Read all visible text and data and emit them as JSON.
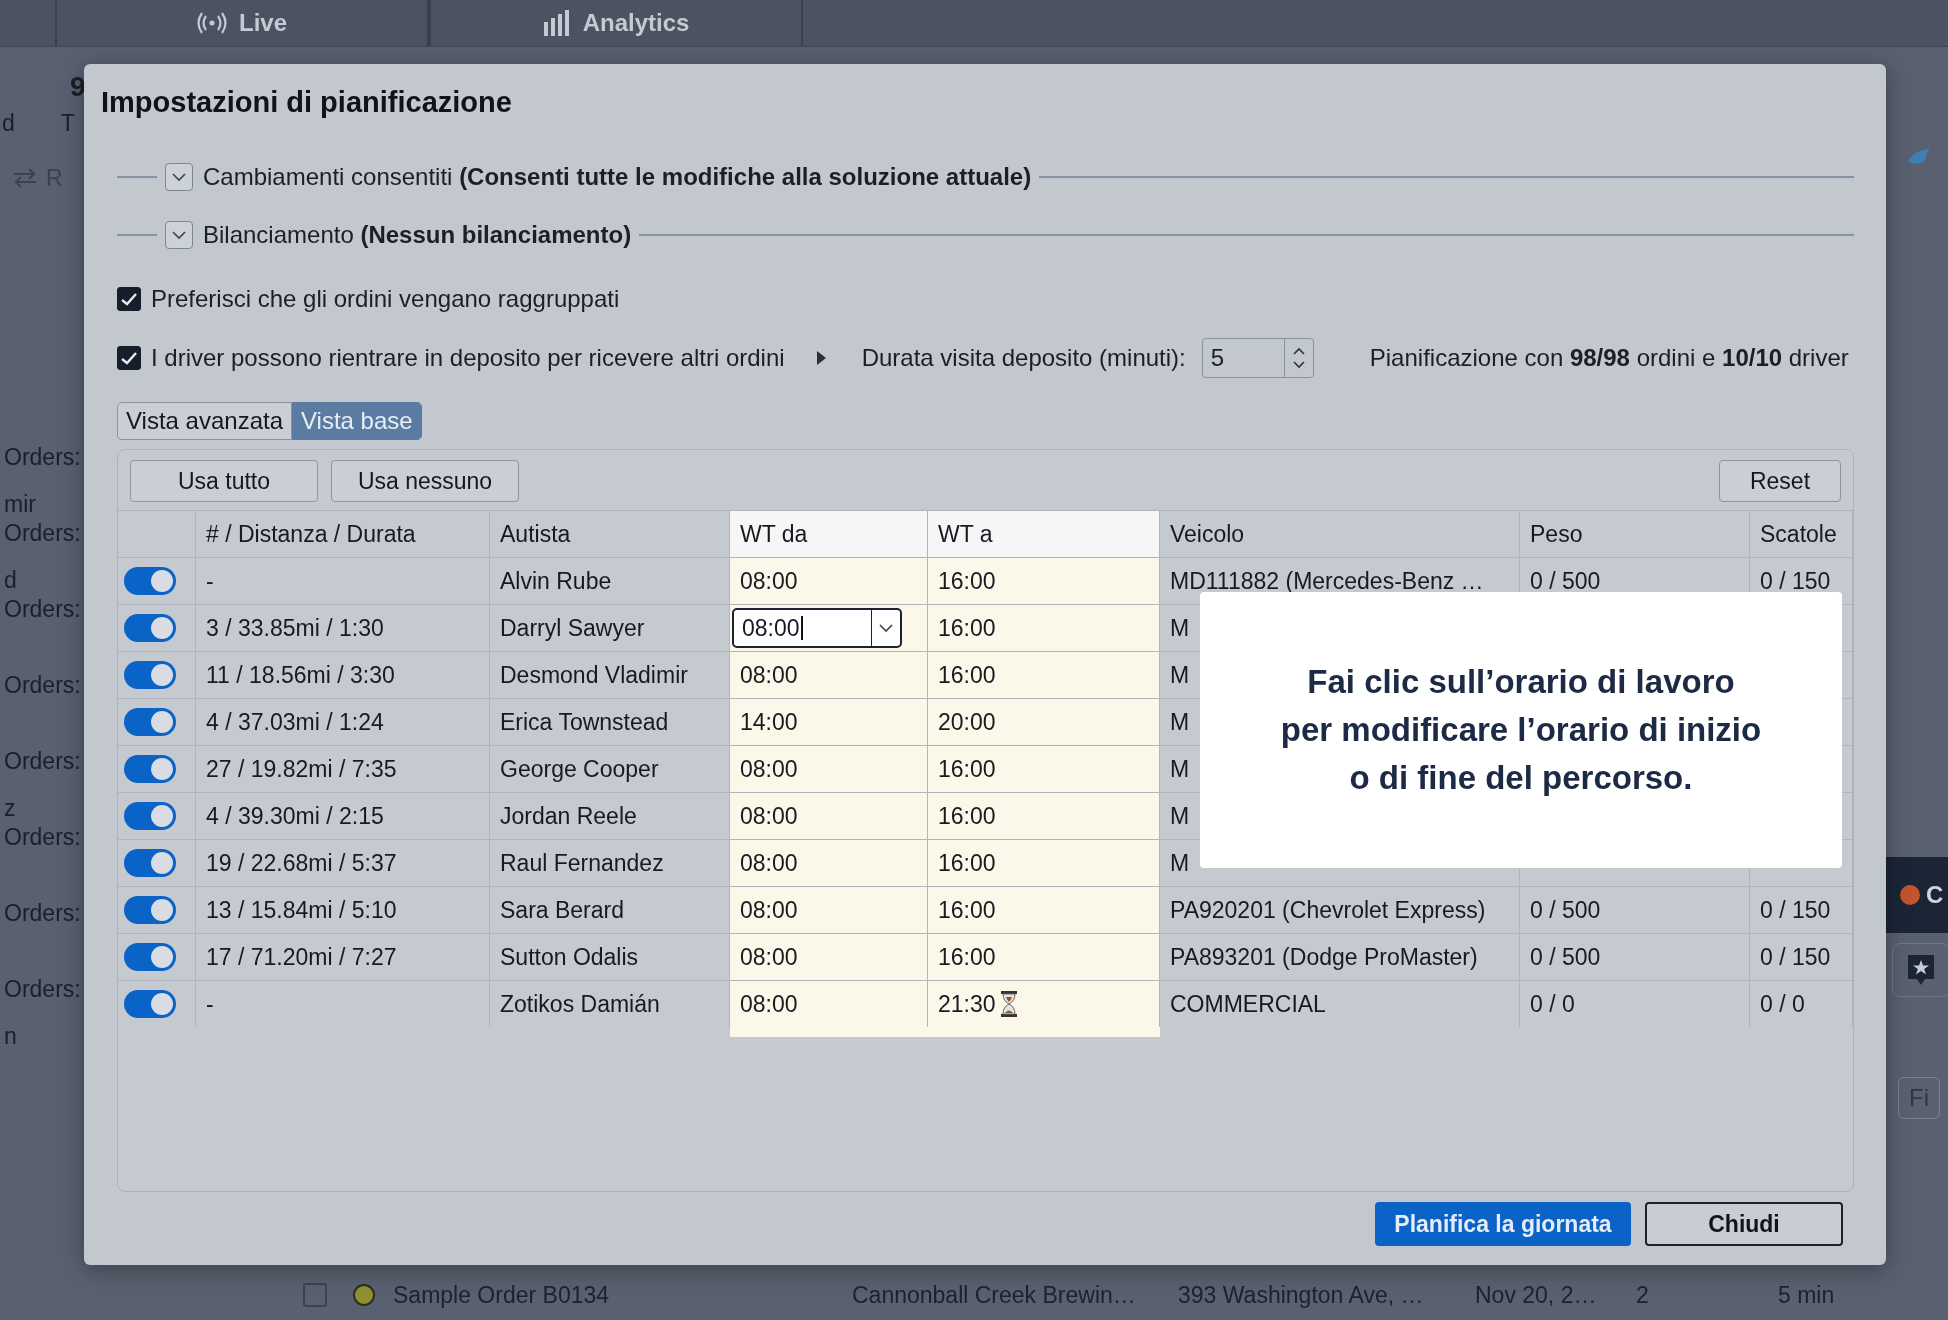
{
  "app_tabs": [
    "Live",
    "Analytics"
  ],
  "sidebar": {
    "heading": "9",
    "line": [
      "d",
      "T"
    ],
    "action": "R",
    "entries": [
      {
        "label": "Orders:"
      },
      {
        "name": "mir",
        "label": "Orders:"
      },
      {
        "name": "d",
        "label": "Orders:"
      },
      {
        "label": "Orders:"
      },
      {
        "label": "Orders:"
      },
      {
        "name": "z",
        "label": "Orders:"
      },
      {
        "label": "Orders:"
      },
      {
        "label": "Orders:"
      },
      {
        "name": "n"
      }
    ]
  },
  "right_panel": {
    "status": {
      "label": "C",
      "color": "#c4532f"
    },
    "filter": "Fi"
  },
  "order_row": {
    "checked": false,
    "color": "#8e9031",
    "cells": [
      "Sample Order B0134",
      "Cannonball Creek Brewin…",
      "393 Washington Ave, …",
      "Nov 20, 2…",
      "2",
      "5 min"
    ]
  },
  "dialog": {
    "title": "Impostazioni di pianificazione",
    "sections": [
      {
        "label": "Cambiamenti consentiti **(Consenti tutte le modifiche alla soluzione attuale)**",
        "expanded": false
      },
      {
        "label": "Bilanciamento **(Nessun bilanciamento)**",
        "expanded": false
      }
    ],
    "options": [
      {
        "label": "Preferisci che gli ordini vengano raggruppati",
        "checked": true
      },
      {
        "label": "I driver possono rientrare in deposito per ricevere altri ordini",
        "checked": true
      }
    ],
    "depot_visit": {
      "label": "Durata visita deposito (minuti):",
      "value": "5"
    },
    "summary": "Pianificazione con **98/98** ordini e **10/10** driver",
    "views": [
      {
        "label": "Vista avanzata",
        "selected": false
      },
      {
        "label": "Vista base",
        "selected": true
      }
    ],
    "table_actions": [
      "Usa tutto",
      "Usa nessuno"
    ],
    "reset": "Reset",
    "columns": [
      {
        "label": "# / Distanza / Durata",
        "highlighted": false
      },
      {
        "label": "Autista",
        "highlighted": false
      },
      {
        "label": "WT da",
        "highlighted": true
      },
      {
        "label": "WT a",
        "highlighted": true
      },
      {
        "label": "Veicolo",
        "highlighted": false
      },
      {
        "label": "Peso",
        "highlighted": false
      },
      {
        "label": "Scatole",
        "highlighted": false
      }
    ],
    "rows": [
      {
        "enabled": true,
        "route": "-",
        "driver": "Alvin Rube",
        "start": "08:00",
        "end": "16:00",
        "vehicle": "MD111882 (Mercedes-Benz …",
        "weight": "0 / 500",
        "boxes": "0 / 150",
        "editing": false,
        "overtime": false
      },
      {
        "enabled": true,
        "route": "3 / 33.85mi / 1:30",
        "driver": "Darryl Sawyer",
        "start": "08:00",
        "end": "16:00",
        "vehicle": "M",
        "editing": true,
        "overtime": false
      },
      {
        "enabled": true,
        "route": "11 / 18.56mi / 3:30",
        "driver": "Desmond Vladimir",
        "start": "08:00",
        "end": "16:00",
        "vehicle": "M",
        "editing": false,
        "overtime": false
      },
      {
        "enabled": true,
        "route": "4 / 37.03mi / 1:24",
        "driver": "Erica Townstead",
        "start": "14:00",
        "end": "20:00",
        "vehicle": "M",
        "editing": false,
        "overtime": false
      },
      {
        "enabled": true,
        "route": "27 / 19.82mi / 7:35",
        "driver": "George Cooper",
        "start": "08:00",
        "end": "16:00",
        "vehicle": "M",
        "editing": false,
        "overtime": false
      },
      {
        "enabled": true,
        "route": "4 / 39.30mi / 2:15",
        "driver": "Jordan Reele",
        "start": "08:00",
        "end": "16:00",
        "vehicle": "M",
        "editing": false,
        "overtime": false
      },
      {
        "enabled": true,
        "route": "19 / 22.68mi / 5:37",
        "driver": "Raul Fernandez",
        "start": "08:00",
        "end": "16:00",
        "vehicle": "M",
        "editing": false,
        "overtime": false
      },
      {
        "enabled": true,
        "route": "13 / 15.84mi / 5:10",
        "driver": "Sara Berard",
        "start": "08:00",
        "end": "16:00",
        "vehicle": "PA920201 (Chevrolet Express)",
        "weight": "0 / 500",
        "boxes": "0 / 150",
        "editing": false,
        "overtime": false
      },
      {
        "enabled": true,
        "route": "17 / 71.20mi / 7:27",
        "driver": "Sutton Odalis",
        "start": "08:00",
        "end": "16:00",
        "vehicle": "PA893201 (Dodge ProMaster)",
        "weight": "0 / 500",
        "boxes": "0 / 150",
        "editing": false,
        "overtime": false
      },
      {
        "enabled": true,
        "route": "-",
        "driver": "Zotikos Damián",
        "start": "08:00",
        "end": "21:30",
        "vehicle": "COMMERCIAL",
        "weight": "0 / 0",
        "boxes": "0 / 0",
        "editing": false,
        "overtime": true
      }
    ],
    "tutorial": "Fai clic sull’orario di lavoro per modificare l’orario di inizio o di fine del percorso.",
    "buttons": [
      {
        "label": "Planifica la giornata",
        "kind": "primary"
      },
      {
        "label": "Chiudi",
        "kind": "secondary"
      }
    ]
  }
}
